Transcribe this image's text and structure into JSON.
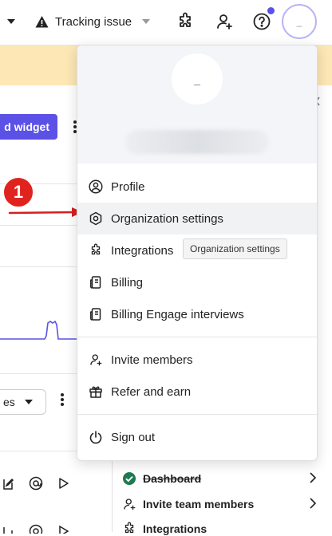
{
  "topbar": {
    "tracking_label": "Tracking issue",
    "avatar_initial": "_"
  },
  "left_content": {
    "widget_button_label": "d widget",
    "step_badge": "1",
    "select_value": "es"
  },
  "checklist": {
    "items": [
      {
        "label": "Dashboard",
        "done": true
      },
      {
        "label": "Invite team members",
        "done": false
      },
      {
        "label": "Integrations",
        "done": false
      }
    ]
  },
  "menu": {
    "avatar_initial": "_",
    "items": [
      {
        "label": "Profile",
        "icon": "user-circle-icon"
      },
      {
        "label": "Organization settings",
        "icon": "gear-icon"
      },
      {
        "label": "Integrations",
        "icon": "puzzle-icon"
      },
      {
        "label": "Billing",
        "icon": "billing-icon"
      },
      {
        "label": "Billing Engage interviews",
        "icon": "billing-icon"
      },
      {
        "label": "Invite members",
        "icon": "user-plus-icon"
      },
      {
        "label": "Refer and earn",
        "icon": "gift-icon"
      },
      {
        "label": "Sign out",
        "icon": "power-icon"
      }
    ],
    "tooltip": "Organization settings"
  },
  "colors": {
    "accent": "#5b51e6",
    "badge_red": "#e0231f",
    "banner": "#fde7b5",
    "check_green": "#1f7a4f"
  }
}
